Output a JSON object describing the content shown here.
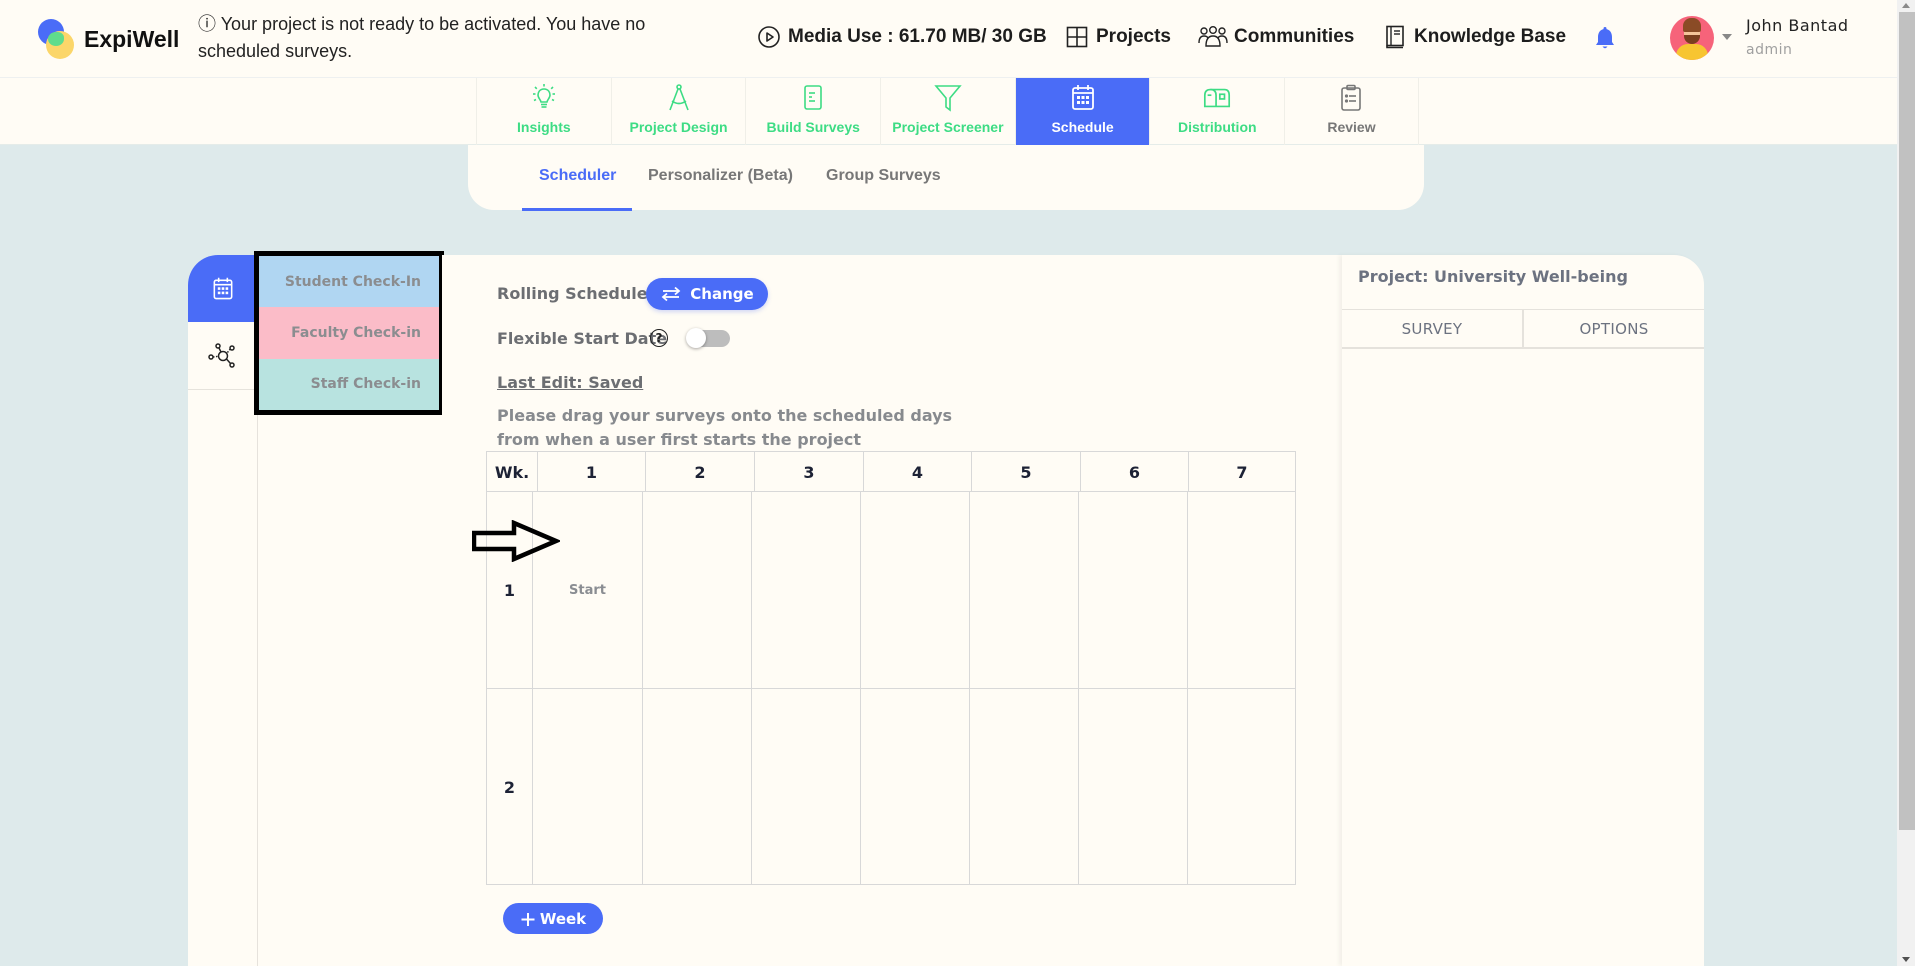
{
  "header": {
    "brand": "ExpiWell",
    "notice_icon": "ⓘ",
    "notice": "Your project is not ready to be activated. You have no scheduled surveys.",
    "nav": [
      {
        "icon": "play-circle-icon",
        "label": "Media Use : 61.70 MB/ 30 GB"
      },
      {
        "icon": "grid-icon",
        "label": "Projects"
      },
      {
        "icon": "people-icon",
        "label": "Communities"
      },
      {
        "icon": "book-icon",
        "label": "Knowledge Base"
      }
    ],
    "notification_icon": "bell-icon",
    "user": {
      "name": "John Bantad",
      "role": "admin"
    }
  },
  "main_tabs": [
    {
      "icon": "lightbulb-icon",
      "label": "Insights",
      "state": "done"
    },
    {
      "icon": "compass-icon",
      "label": "Project Design",
      "state": "done"
    },
    {
      "icon": "document-icon",
      "label": "Build Surveys",
      "state": "done"
    },
    {
      "icon": "filter-icon",
      "label": "Project Screener",
      "state": "done"
    },
    {
      "icon": "calendar-icon",
      "label": "Schedule",
      "state": "active"
    },
    {
      "icon": "mailbox-icon",
      "label": "Distribution",
      "state": "done"
    },
    {
      "icon": "clipboard-icon",
      "label": "Review",
      "state": "pending"
    }
  ],
  "sub_tabs": [
    {
      "label": "Scheduler",
      "active": true
    },
    {
      "label": "Personalizer (Beta)",
      "active": false
    },
    {
      "label": "Group Surveys",
      "active": false
    }
  ],
  "side_icons": [
    "calendar-icon",
    "network-icon"
  ],
  "surveys": [
    {
      "label": "Student Check-In",
      "color": "#b0d6f2"
    },
    {
      "label": "Faculty Check-in",
      "color": "#fbbcc8"
    },
    {
      "label": "Staff Check-in",
      "color": "#b8e3e0"
    }
  ],
  "scheduler": {
    "schedule_type_label": "Rolling Schedule",
    "change_button": "Change",
    "flexible_start_label": "Flexible Start Date",
    "help_icon": "?",
    "flexible_start_enabled": false,
    "last_edit": "Last Edit: Saved",
    "instructions": "Please drag your surveys onto the scheduled days from when a user first starts the project",
    "grid": {
      "week_header": "Wk.",
      "days": [
        "1",
        "2",
        "3",
        "4",
        "5",
        "6",
        "7"
      ],
      "weeks": [
        {
          "week": "1",
          "cells": [
            "Start",
            "",
            "",
            "",
            "",
            "",
            ""
          ]
        },
        {
          "week": "2",
          "cells": [
            "",
            "",
            "",
            "",
            "",
            "",
            ""
          ]
        }
      ]
    },
    "add_week_button": "Week"
  },
  "right_panel": {
    "project": "Project: University Well-being",
    "columns": [
      "SURVEY",
      "OPTIONS"
    ]
  },
  "colors": {
    "accent": "#4a6cf7",
    "done_green": "#3ddc84",
    "background": "#deeaeb",
    "card": "#fffcf5"
  }
}
